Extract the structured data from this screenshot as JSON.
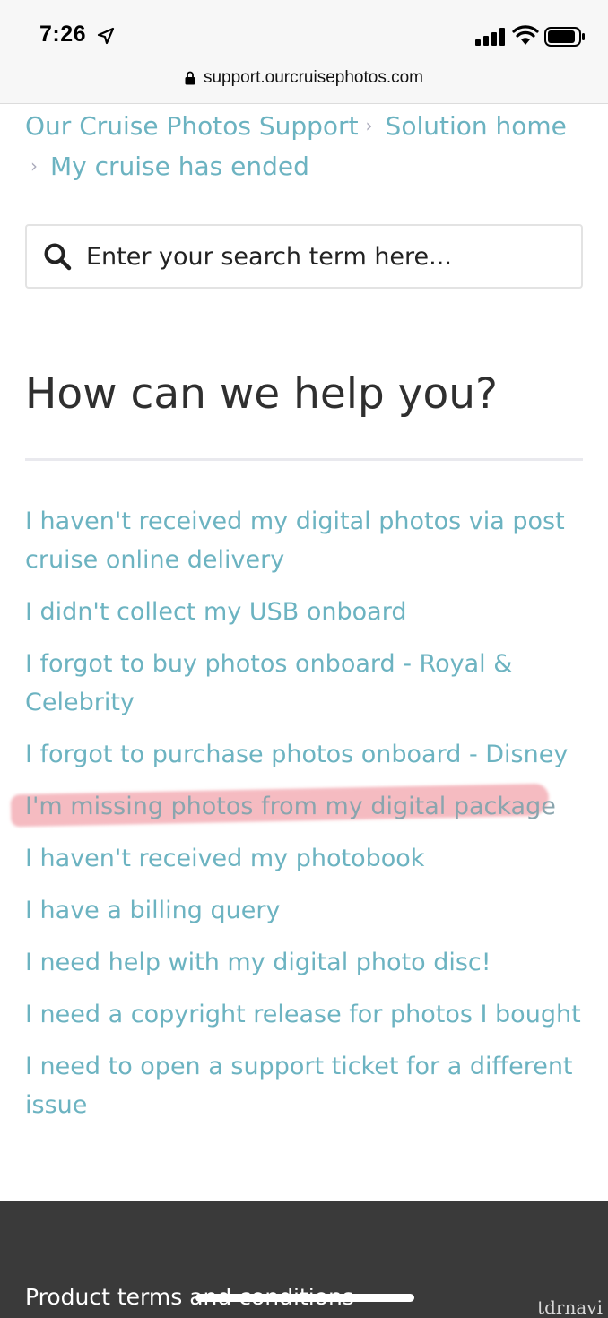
{
  "status_bar": {
    "time": "7:26",
    "url": "support.ourcruisephotos.com"
  },
  "breadcrumb": {
    "items": [
      "Our Cruise Photos Support",
      "Solution home",
      "My cruise has ended"
    ],
    "separator": "›"
  },
  "search": {
    "placeholder": "Enter your search term here..."
  },
  "main": {
    "title": "How can we help you?",
    "solutions": [
      {
        "label": "I haven't received my digital photos via post cruise online delivery"
      },
      {
        "label": "I didn't collect my USB onboard"
      },
      {
        "label": "I forgot to buy photos onboard - Royal & Celebrity"
      },
      {
        "label": "I forgot to purchase photos onboard - Disney"
      },
      {
        "label": "I'm missing photos from my digital package",
        "highlighted": true
      },
      {
        "label": "I haven't received my photobook"
      },
      {
        "label": "I have a billing query"
      },
      {
        "label": "I need help with my digital photo disc!"
      },
      {
        "label": "I need a copyright release for photos I bought"
      },
      {
        "label": "I need to open a support ticket for a different issue"
      }
    ]
  },
  "footer": {
    "link": "Product terms and conditions"
  },
  "watermark": "tdrnavi",
  "colors": {
    "link": "#6cb3c1",
    "highlight": "#f0a0aa",
    "footer_bg": "#3a3a3a"
  }
}
